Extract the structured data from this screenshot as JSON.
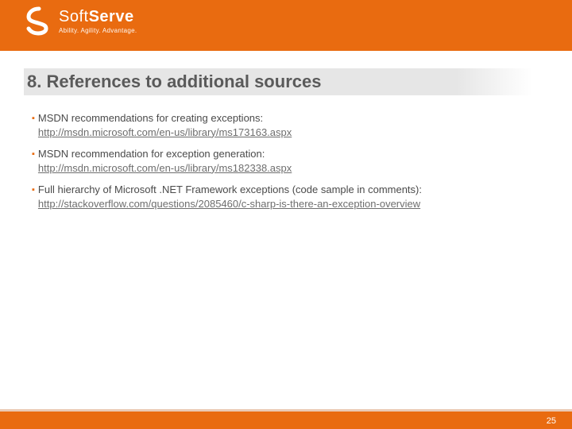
{
  "brand": {
    "name_a": "Soft",
    "name_b": "Serve",
    "tagline": "Ability. Agility. Advantage."
  },
  "heading": "8. References to additional sources",
  "bullets": [
    {
      "text": "MSDN recommendations for creating exceptions:",
      "link": "http://msdn.microsoft.com/en-us/library/ms173163.aspx"
    },
    {
      "text": "MSDN recommendation for exception generation:",
      "link": "http://msdn.microsoft.com/en-us/library/ms182338.aspx"
    },
    {
      "text": "Full hierarchy of Microsoft .NET Framework exceptions (code sample in comments):",
      "link": "http://stackoverflow.com/questions/2085460/c-sharp-is-there-an-exception-overview"
    }
  ],
  "page_number": "25"
}
